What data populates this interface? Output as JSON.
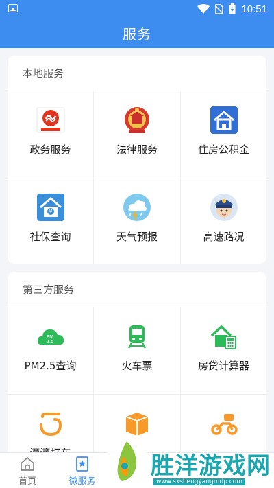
{
  "status": {
    "time": "10:51"
  },
  "header": {
    "title": "服务"
  },
  "local_services": {
    "title": "本地服务",
    "items": [
      {
        "label": "政务服务",
        "icon": "government-logo-icon"
      },
      {
        "label": "法律服务",
        "icon": "court-emblem-icon"
      },
      {
        "label": "住房公积金",
        "icon": "house-fund-icon"
      },
      {
        "label": "社保查询",
        "icon": "social-security-icon"
      },
      {
        "label": "天气预报",
        "icon": "weather-icon"
      },
      {
        "label": "高速路况",
        "icon": "traffic-police-icon"
      }
    ]
  },
  "third_party_services": {
    "title": "第三方服务",
    "items": [
      {
        "label": "PM2.5查询",
        "icon": "pm25-cloud-icon"
      },
      {
        "label": "火车票",
        "icon": "train-icon"
      },
      {
        "label": "房贷计算器",
        "icon": "mortgage-calculator-icon"
      },
      {
        "label": "滴滴打车",
        "icon": "didi-icon"
      },
      {
        "label": "",
        "icon": "package-icon"
      },
      {
        "label": "",
        "icon": "scooter-icon"
      }
    ]
  },
  "nav": {
    "home": "首页",
    "services": "微服务"
  },
  "watermark": {
    "text": "胜洋游戏网",
    "url": "www.sxshengyangmdp.com"
  },
  "colors": {
    "primary": "#3d8df0",
    "green": "#2dbb5a",
    "orange": "#f79a2a"
  }
}
